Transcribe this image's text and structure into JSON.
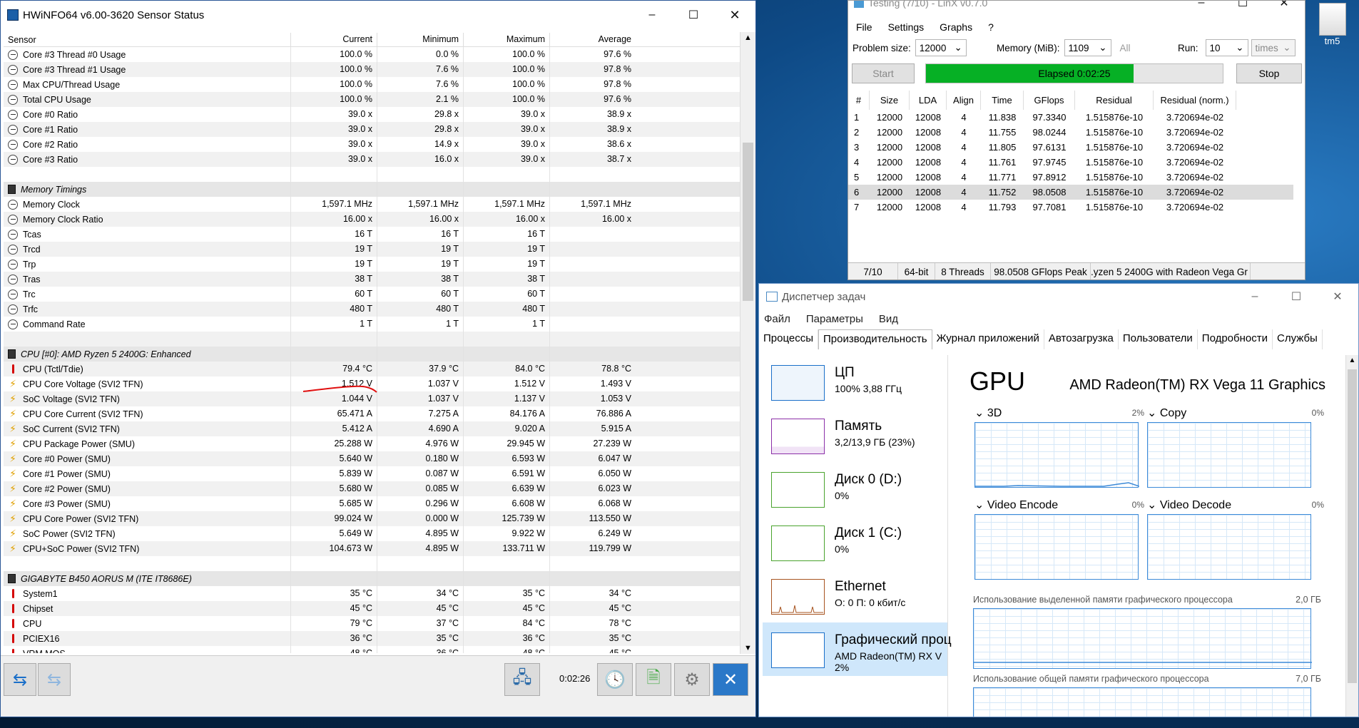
{
  "desktop": {
    "icon_label": "tm5"
  },
  "hwinfo": {
    "title": "HWiNFO64 v6.00-3620 Sensor Status",
    "columns": [
      "Sensor",
      "Current",
      "Minimum",
      "Maximum",
      "Average"
    ],
    "rows": [
      {
        "t": "s",
        "i": "clock",
        "n": "Core #3 Thread #0 Usage",
        "c": "100.0 %",
        "mi": "0.0 %",
        "ma": "100.0 %",
        "av": "97.6 %"
      },
      {
        "t": "s",
        "i": "clock",
        "n": "Core #3 Thread #1 Usage",
        "c": "100.0 %",
        "mi": "7.6 %",
        "ma": "100.0 %",
        "av": "97.8 %"
      },
      {
        "t": "s",
        "i": "clock",
        "n": "Max CPU/Thread Usage",
        "c": "100.0 %",
        "mi": "7.6 %",
        "ma": "100.0 %",
        "av": "97.8 %"
      },
      {
        "t": "s",
        "i": "clock",
        "n": "Total CPU Usage",
        "c": "100.0 %",
        "mi": "2.1 %",
        "ma": "100.0 %",
        "av": "97.6 %"
      },
      {
        "t": "s",
        "i": "clock",
        "n": "Core #0 Ratio",
        "c": "39.0 x",
        "mi": "29.8 x",
        "ma": "39.0 x",
        "av": "38.9 x"
      },
      {
        "t": "s",
        "i": "clock",
        "n": "Core #1 Ratio",
        "c": "39.0 x",
        "mi": "29.8 x",
        "ma": "39.0 x",
        "av": "38.9 x"
      },
      {
        "t": "s",
        "i": "clock",
        "n": "Core #2 Ratio",
        "c": "39.0 x",
        "mi": "14.9 x",
        "ma": "39.0 x",
        "av": "38.6 x"
      },
      {
        "t": "s",
        "i": "clock",
        "n": "Core #3 Ratio",
        "c": "39.0 x",
        "mi": "16.0 x",
        "ma": "39.0 x",
        "av": "38.7 x"
      },
      {
        "t": "e"
      },
      {
        "t": "g",
        "n": "Memory Timings"
      },
      {
        "t": "s",
        "i": "clock",
        "n": "Memory Clock",
        "c": "1,597.1 MHz",
        "mi": "1,597.1 MHz",
        "ma": "1,597.1 MHz",
        "av": "1,597.1 MHz"
      },
      {
        "t": "s",
        "i": "clock",
        "n": "Memory Clock Ratio",
        "c": "16.00 x",
        "mi": "16.00 x",
        "ma": "16.00 x",
        "av": "16.00 x"
      },
      {
        "t": "s",
        "i": "clock",
        "n": "Tcas",
        "c": "16 T",
        "mi": "16 T",
        "ma": "16 T",
        "av": ""
      },
      {
        "t": "s",
        "i": "clock",
        "n": "Trcd",
        "c": "19 T",
        "mi": "19 T",
        "ma": "19 T",
        "av": ""
      },
      {
        "t": "s",
        "i": "clock",
        "n": "Trp",
        "c": "19 T",
        "mi": "19 T",
        "ma": "19 T",
        "av": ""
      },
      {
        "t": "s",
        "i": "clock",
        "n": "Tras",
        "c": "38 T",
        "mi": "38 T",
        "ma": "38 T",
        "av": ""
      },
      {
        "t": "s",
        "i": "clock",
        "n": "Trc",
        "c": "60 T",
        "mi": "60 T",
        "ma": "60 T",
        "av": ""
      },
      {
        "t": "s",
        "i": "clock",
        "n": "Trfc",
        "c": "480 T",
        "mi": "480 T",
        "ma": "480 T",
        "av": ""
      },
      {
        "t": "s",
        "i": "clock",
        "n": "Command Rate",
        "c": "1 T",
        "mi": "1 T",
        "ma": "1 T",
        "av": ""
      },
      {
        "t": "e"
      },
      {
        "t": "g",
        "n": "CPU [#0]: AMD Ryzen 5 2400G: Enhanced"
      },
      {
        "t": "s",
        "i": "temp",
        "n": "CPU (Tctl/Tdie)",
        "c": "79.4 °C",
        "mi": "37.9 °C",
        "ma": "84.0 °C",
        "av": "78.8 °C"
      },
      {
        "t": "s",
        "i": "volt",
        "n": "CPU Core Voltage (SVI2 TFN)",
        "c": "1.512 V",
        "mi": "1.037 V",
        "ma": "1.512 V",
        "av": "1.493 V"
      },
      {
        "t": "s",
        "i": "volt",
        "n": "SoC Voltage (SVI2 TFN)",
        "c": "1.044 V",
        "mi": "1.037 V",
        "ma": "1.137 V",
        "av": "1.053 V"
      },
      {
        "t": "s",
        "i": "volt",
        "n": "CPU Core Current (SVI2 TFN)",
        "c": "65.471 A",
        "mi": "7.275 A",
        "ma": "84.176 A",
        "av": "76.886 A"
      },
      {
        "t": "s",
        "i": "volt",
        "n": "SoC Current (SVI2 TFN)",
        "c": "5.412 A",
        "mi": "4.690 A",
        "ma": "9.020 A",
        "av": "5.915 A"
      },
      {
        "t": "s",
        "i": "volt",
        "n": "CPU Package Power (SMU)",
        "c": "25.288 W",
        "mi": "4.976 W",
        "ma": "29.945 W",
        "av": "27.239 W"
      },
      {
        "t": "s",
        "i": "volt",
        "n": "Core #0 Power (SMU)",
        "c": "5.640 W",
        "mi": "0.180 W",
        "ma": "6.593 W",
        "av": "6.047 W"
      },
      {
        "t": "s",
        "i": "volt",
        "n": "Core #1 Power (SMU)",
        "c": "5.839 W",
        "mi": "0.087 W",
        "ma": "6.591 W",
        "av": "6.050 W"
      },
      {
        "t": "s",
        "i": "volt",
        "n": "Core #2 Power (SMU)",
        "c": "5.680 W",
        "mi": "0.085 W",
        "ma": "6.639 W",
        "av": "6.023 W"
      },
      {
        "t": "s",
        "i": "volt",
        "n": "Core #3 Power (SMU)",
        "c": "5.685 W",
        "mi": "0.296 W",
        "ma": "6.608 W",
        "av": "6.068 W"
      },
      {
        "t": "s",
        "i": "volt",
        "n": "CPU Core Power (SVI2 TFN)",
        "c": "99.024 W",
        "mi": "0.000 W",
        "ma": "125.739 W",
        "av": "113.550 W"
      },
      {
        "t": "s",
        "i": "volt",
        "n": "SoC Power (SVI2 TFN)",
        "c": "5.649 W",
        "mi": "4.895 W",
        "ma": "9.922 W",
        "av": "6.249 W"
      },
      {
        "t": "s",
        "i": "volt",
        "n": "CPU+SoC Power (SVI2 TFN)",
        "c": "104.673 W",
        "mi": "4.895 W",
        "ma": "133.711 W",
        "av": "119.799 W"
      },
      {
        "t": "e"
      },
      {
        "t": "g",
        "n": "GIGABYTE B450 AORUS M (ITE IT8686E)"
      },
      {
        "t": "s",
        "i": "temp",
        "n": "System1",
        "c": "35 °C",
        "mi": "34 °C",
        "ma": "35 °C",
        "av": "34 °C"
      },
      {
        "t": "s",
        "i": "temp",
        "n": "Chipset",
        "c": "45 °C",
        "mi": "45 °C",
        "ma": "45 °C",
        "av": "45 °C"
      },
      {
        "t": "s",
        "i": "temp",
        "n": "CPU",
        "c": "79 °C",
        "mi": "37 °C",
        "ma": "84 °C",
        "av": "78 °C"
      },
      {
        "t": "s",
        "i": "temp",
        "n": "PCIEX16",
        "c": "36 °C",
        "mi": "35 °C",
        "ma": "36 °C",
        "av": "35 °C"
      },
      {
        "t": "s",
        "i": "temp",
        "n": "VRM MOS",
        "c": "48 °C",
        "mi": "36 °C",
        "ma": "48 °C",
        "av": "45 °C"
      }
    ],
    "elapsed": "0:02:26"
  },
  "linx": {
    "title": "Testing (7/10) - LinX v0.7.0",
    "menu": [
      "File",
      "Settings",
      "Graphs",
      "?"
    ],
    "problem_size_label": "Problem size:",
    "problem_size": "12000",
    "memory_label": "Memory (MiB):",
    "memory": "1109",
    "all_label": "All",
    "run_label": "Run:",
    "run": "10",
    "run_unit": "times",
    "start_label": "Start",
    "elapsed": "Elapsed 0:02:25",
    "stop_label": "Stop",
    "progress": 0.7,
    "columns": [
      "#",
      "Size",
      "LDA",
      "Align",
      "Time",
      "GFlops",
      "Residual",
      "Residual (norm.)"
    ],
    "rows": [
      [
        "1",
        "12000",
        "12008",
        "4",
        "11.838",
        "97.3340",
        "1.515876e-10",
        "3.720694e-02"
      ],
      [
        "2",
        "12000",
        "12008",
        "4",
        "11.755",
        "98.0244",
        "1.515876e-10",
        "3.720694e-02"
      ],
      [
        "3",
        "12000",
        "12008",
        "4",
        "11.805",
        "97.6131",
        "1.515876e-10",
        "3.720694e-02"
      ],
      [
        "4",
        "12000",
        "12008",
        "4",
        "11.761",
        "97.9745",
        "1.515876e-10",
        "3.720694e-02"
      ],
      [
        "5",
        "12000",
        "12008",
        "4",
        "11.771",
        "97.8912",
        "1.515876e-10",
        "3.720694e-02"
      ],
      [
        "6",
        "12000",
        "12008",
        "4",
        "11.752",
        "98.0508",
        "1.515876e-10",
        "3.720694e-02"
      ],
      [
        "7",
        "12000",
        "12008",
        "4",
        "11.793",
        "97.7081",
        "1.515876e-10",
        "3.720694e-02"
      ]
    ],
    "status": [
      "7/10",
      "64-bit",
      "8 Threads",
      "98.0508 GFlops Peak",
      ".yzen 5 2400G with Radeon Vega Gr"
    ]
  },
  "taskmgr": {
    "title": "Диспетчер задач",
    "menu": [
      "Файл",
      "Параметры",
      "Вид"
    ],
    "tabs": [
      "Процессы",
      "Производительность",
      "Журнал приложений",
      "Автозагрузка",
      "Пользователи",
      "Подробности",
      "Службы"
    ],
    "tiles": [
      {
        "name": "ЦП",
        "sub": "100% 3,88 ГГц",
        "color": "#1a6fc9"
      },
      {
        "name": "Память",
        "sub": "3,2/13,9 ГБ (23%)",
        "color": "#8b2fa8"
      },
      {
        "name": "Диск 0 (D:)",
        "sub": "0%",
        "color": "#4aa32d"
      },
      {
        "name": "Диск 1 (C:)",
        "sub": "0%",
        "color": "#4aa32d"
      },
      {
        "name": "Ethernet",
        "sub": "О: 0 П: 0 кбит/с",
        "color": "#a7531f"
      },
      {
        "name": "Графический проц",
        "sub": "AMD Radeon(TM) RX V",
        "sub2": "2%",
        "color": "#1a6fc9"
      }
    ],
    "gpu": {
      "heading": "GPU",
      "model": "AMD Radeon(TM) RX Vega 11 Graphics",
      "engines": [
        {
          "name": "3D",
          "pct": "2%"
        },
        {
          "name": "Copy",
          "pct": "0%"
        },
        {
          "name": "Video Encode",
          "pct": "0%"
        },
        {
          "name": "Video Decode",
          "pct": "0%"
        }
      ],
      "dedicated_label": "Использование выделенной памяти графического процессора",
      "dedicated_max": "2,0 ГБ",
      "shared_label": "Использование общей памяти графического процессора",
      "shared_max": "7,0 ГБ"
    }
  }
}
